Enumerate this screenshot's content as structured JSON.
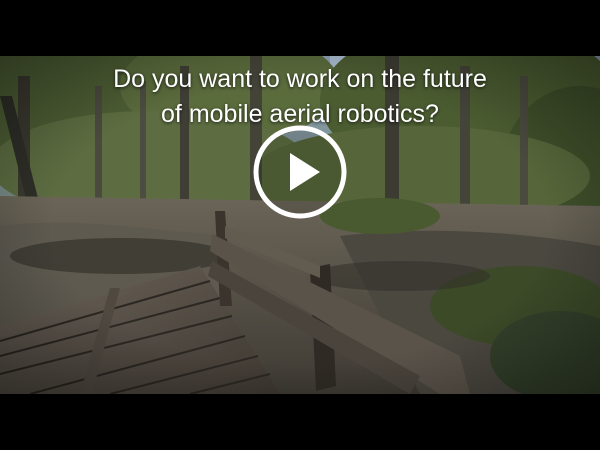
{
  "video": {
    "overlay_line_1": "Do you want to work on the future",
    "overlay_line_2": "of mobile aerial robotics?",
    "play_icon": "play-icon",
    "colors": {
      "letterbox": "#000000",
      "overlay_text": "#ffffff",
      "play_button": "#ffffff"
    }
  }
}
